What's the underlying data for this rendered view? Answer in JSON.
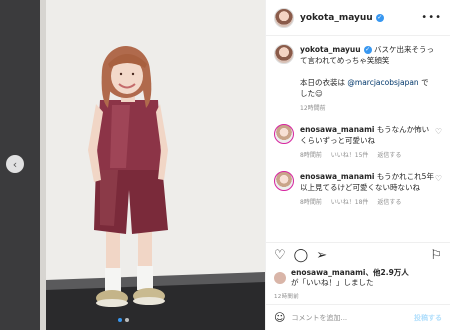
{
  "post": {
    "username": "yokota_mayuu",
    "caption_user": "yokota_mayuu",
    "caption_line1": " バスケ出来そうって言われてめっちゃ笑顔笑",
    "caption_line2_prefix": "本日の衣装は ",
    "caption_mention": "@marcjacobsjapan",
    "caption_line2_suffix": " でした☺︎",
    "caption_time": "12時間前",
    "more_icon": "more-dots-icon"
  },
  "comments": [
    {
      "user": "enosawa_manami",
      "text": " もうなんか怖いくらいずっと可愛いね",
      "time": "8時間前",
      "likes": "いいね！15件",
      "reply": "返信する"
    },
    {
      "user": "enosawa_manami",
      "text": " もうかれこれ5年以上見てるけど可愛くない時ないね",
      "time": "8時間前",
      "likes": "いいね！18件",
      "reply": "返信する"
    }
  ],
  "likes_line": {
    "user": "enosawa_manami",
    "rest": "、他2.9万人",
    "line2": "が「いいね！」しました"
  },
  "date": "12時間前",
  "add_comment": {
    "placeholder": "コメントを追加...",
    "post_label": "投稿する"
  },
  "icons": {
    "heart": "heart-icon",
    "comment": "comment-icon",
    "share": "share-icon",
    "bookmark": "bookmark-icon",
    "smile": "emoji-icon",
    "prev": "chevron-left-icon"
  },
  "colors": {
    "verified": "#3897f0",
    "mention": "#00376b",
    "outfit": "#7a2a3a"
  }
}
